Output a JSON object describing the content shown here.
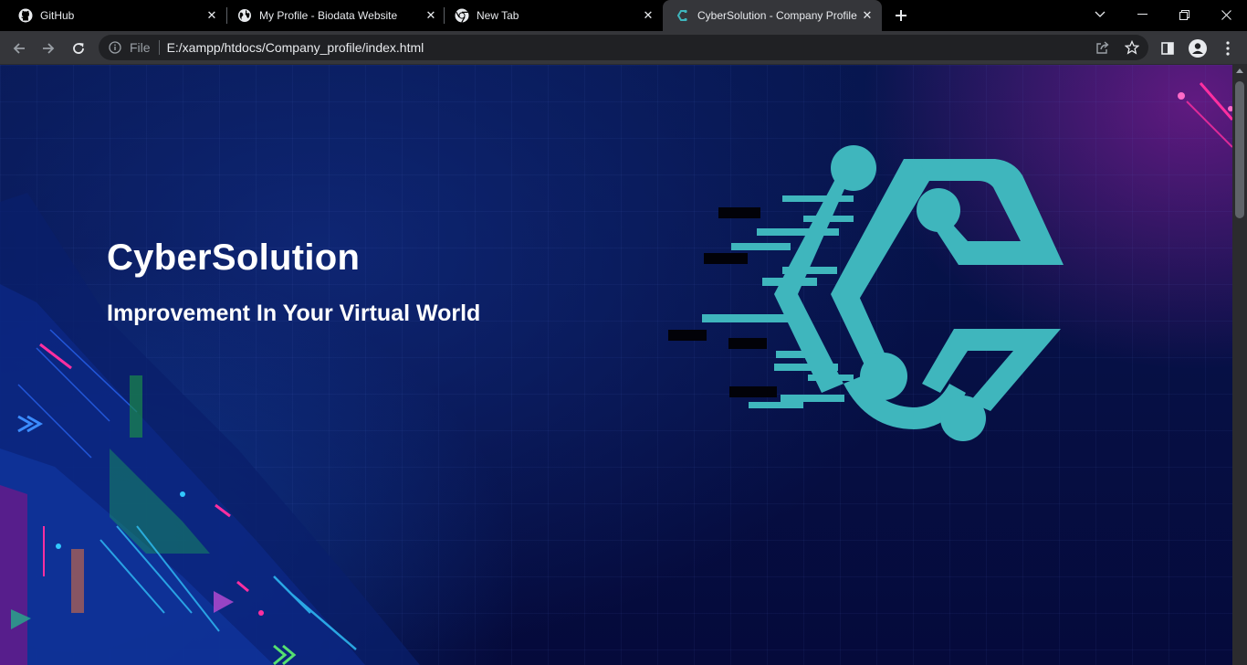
{
  "browser": {
    "tabs": [
      {
        "title": "GitHub",
        "icon": "github-icon",
        "active": false
      },
      {
        "title": "My Profile - Biodata Website",
        "icon": "globe-icon",
        "active": false
      },
      {
        "title": "New Tab",
        "icon": "chrome-icon",
        "active": false
      },
      {
        "title": "CyberSolution - Company Profile",
        "icon": "cybersolution-favicon",
        "active": true
      }
    ],
    "address": {
      "scheme": "File",
      "url": "E:/xampp/htdocs/Company_profile/index.html"
    }
  },
  "page": {
    "title": "CyberSolution",
    "subtitle": "Improvement In Your Virtual World"
  },
  "colors": {
    "logo_teal": "#3fb6bd",
    "accent_pink": "#ff2fa0",
    "background_navy": "#050a3b"
  }
}
